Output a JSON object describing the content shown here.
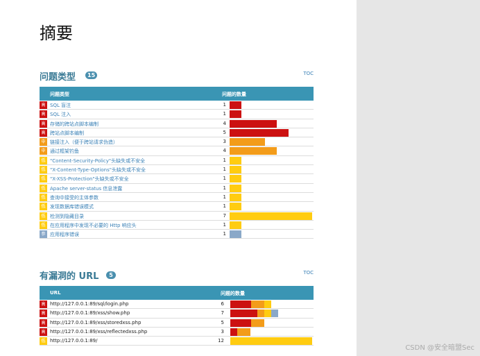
{
  "page": {
    "title": "摘要",
    "watermark": "CSDN @安全暗盟Sec"
  },
  "colors": {
    "high": "#cc1111",
    "medium": "#f39c1a",
    "low": "#ffcc11",
    "info": "#8aa8c8",
    "header": "#3a95b4"
  },
  "issue_types": {
    "title": "问题类型",
    "badge": "15",
    "toc": "TOC",
    "col_name": "问题类型",
    "col_count": "问题的数量",
    "max": 7,
    "rows": [
      {
        "sev": "h",
        "sev_label": "高",
        "name": "SQL 盲注",
        "count": "1",
        "n": 1
      },
      {
        "sev": "h",
        "sev_label": "高",
        "name": "SQL 注入",
        "count": "1",
        "n": 1
      },
      {
        "sev": "h",
        "sev_label": "高",
        "name": "存储的跨站点脚本编制",
        "count": "4",
        "n": 4
      },
      {
        "sev": "h",
        "sev_label": "高",
        "name": "跨站点脚本编制",
        "count": "5",
        "n": 5
      },
      {
        "sev": "m",
        "sev_label": "中",
        "name": "链接注入（便于跨站请求伪造）",
        "count": "3",
        "n": 3
      },
      {
        "sev": "m",
        "sev_label": "中",
        "name": "通过框架钓鱼",
        "count": "4",
        "n": 4
      },
      {
        "sev": "l",
        "sev_label": "低",
        "name": "\"Content-Security-Policy\"头缺失或不安全",
        "count": "1",
        "n": 1
      },
      {
        "sev": "l",
        "sev_label": "低",
        "name": "\"X-Content-Type-Options\"头缺失或不安全",
        "count": "1",
        "n": 1
      },
      {
        "sev": "l",
        "sev_label": "低",
        "name": "\"X-XSS-Protection\"头缺失或不安全",
        "count": "1",
        "n": 1
      },
      {
        "sev": "l",
        "sev_label": "低",
        "name": "Apache server-status 信息泄露",
        "count": "1",
        "n": 1
      },
      {
        "sev": "l",
        "sev_label": "低",
        "name": "查询中接受的主体参数",
        "count": "1",
        "n": 1
      },
      {
        "sev": "l",
        "sev_label": "低",
        "name": "发现数据库错误模式",
        "count": "1",
        "n": 1
      },
      {
        "sev": "l",
        "sev_label": "低",
        "name": "检测到隐藏目录",
        "count": "7",
        "n": 7
      },
      {
        "sev": "l",
        "sev_label": "低",
        "name": "在应用程序中发现不必要的 Http 响应头",
        "count": "1",
        "n": 1
      },
      {
        "sev": "i",
        "sev_label": "参",
        "name": "应用程序错误",
        "count": "1",
        "n": 1
      }
    ]
  },
  "vuln_urls": {
    "title": "有漏洞的 URL",
    "badge": "5",
    "toc": "TOC",
    "col_name": "URL",
    "col_count": "问题的数量",
    "max": 12,
    "rows": [
      {
        "sev": "h",
        "sev_label": "高",
        "name": "http://127.0.0.1:89/sql/login.php",
        "count": "6",
        "parts": [
          3,
          2,
          1,
          0
        ]
      },
      {
        "sev": "h",
        "sev_label": "高",
        "name": "http://127.0.0.1:89/xss/show.php",
        "count": "7",
        "parts": [
          4,
          1,
          1,
          1
        ]
      },
      {
        "sev": "h",
        "sev_label": "高",
        "name": "http://127.0.0.1:89/xss/storedxss.php",
        "count": "5",
        "parts": [
          3,
          2,
          0,
          0
        ]
      },
      {
        "sev": "h",
        "sev_label": "高",
        "name": "http://127.0.0.1:89/xss/reflectedxss.php",
        "count": "3",
        "parts": [
          1,
          2,
          0,
          0
        ]
      },
      {
        "sev": "l",
        "sev_label": "低",
        "name": "http://127.0.0.1:89/",
        "count": "12",
        "parts": [
          0,
          0,
          12,
          0
        ]
      }
    ]
  }
}
